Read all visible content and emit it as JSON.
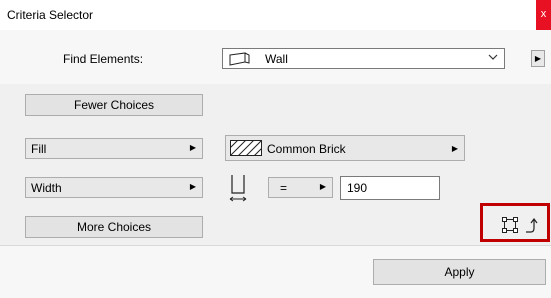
{
  "window": {
    "title": "Criteria Selector",
    "close_label": "x"
  },
  "find": {
    "label": "Find Elements:",
    "value": "Wall",
    "icon": "wall-icon",
    "dropdown_icon": "chevron-down-icon",
    "side_arrow_icon": "triangle-right-icon"
  },
  "buttons": {
    "fewer": "Fewer Choices",
    "more": "More Choices",
    "apply": "Apply"
  },
  "criteria": [
    {
      "property": "Fill",
      "value": "Common Brick",
      "value_icon": "hatch-pattern-icon"
    },
    {
      "property": "Width",
      "operator": "=",
      "value": "190",
      "icon": "height-dimension-icon"
    }
  ],
  "icon_group": {
    "icons": [
      "rectangle-selection-icon",
      "curved-arrow-icon"
    ],
    "highlight_color": "#c00000"
  },
  "colors": {
    "close_button": "#e81123"
  }
}
